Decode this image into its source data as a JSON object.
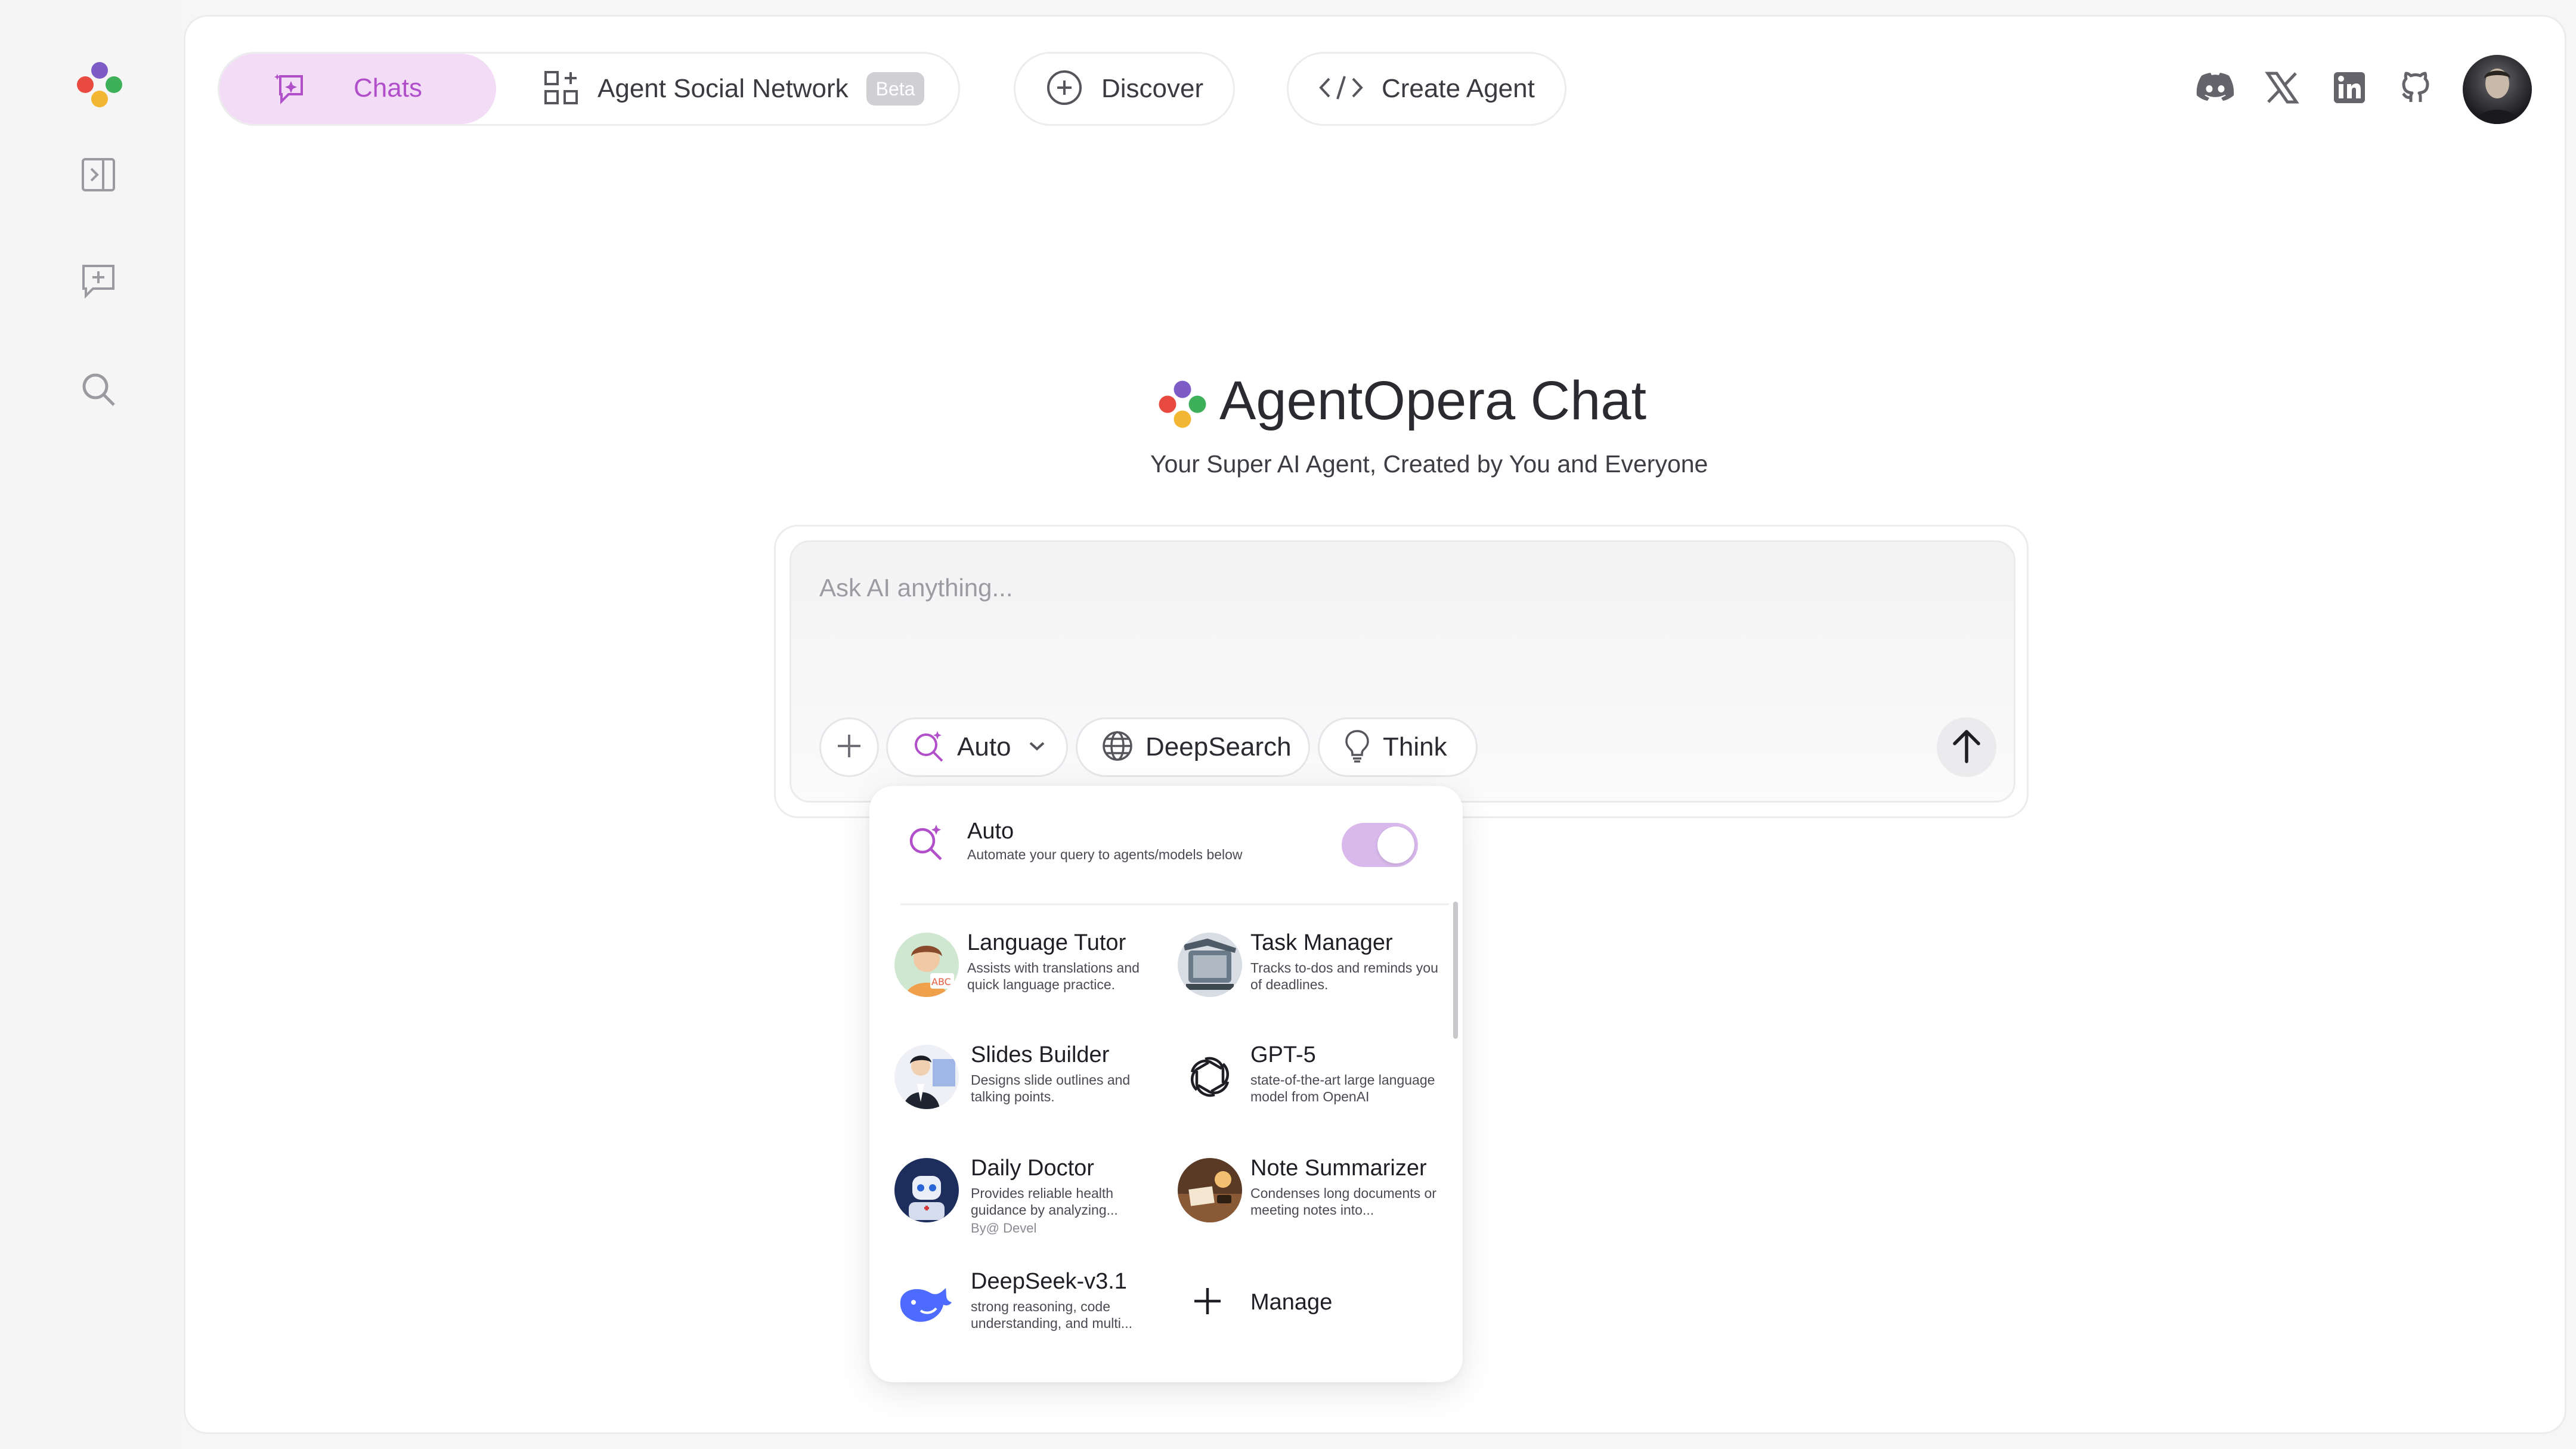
{
  "nav": {
    "chats": "Chats",
    "agent_social_network": "Agent Social Network",
    "beta_badge": "Beta",
    "discover": "Discover",
    "create_agent": "Create Agent"
  },
  "hero": {
    "title": "AgentOpera Chat",
    "subtitle": "Your Super AI Agent, Created by You and Everyone"
  },
  "composer": {
    "placeholder": "Ask AI anything...",
    "auto": "Auto",
    "deepsearch": "DeepSearch",
    "think": "Think"
  },
  "dropdown": {
    "auto_title": "Auto",
    "auto_desc": "Automate your query to agents/models below",
    "auto_enabled": true,
    "agents": [
      {
        "title": "Language Tutor",
        "desc": "Assists with translations and quick language practice."
      },
      {
        "title": "Task Manager",
        "desc": "Tracks to-dos and reminds you of deadlines."
      },
      {
        "title": "Slides Builder",
        "desc": "Designs slide outlines and talking points."
      },
      {
        "title": "GPT-5",
        "desc": "state-of-the-art large language model from OpenAI"
      },
      {
        "title": "Daily Doctor",
        "desc": "Provides reliable health guidance by analyzing...",
        "by": "By@ Devel"
      },
      {
        "title": "Note Summarizer",
        "desc": "Condenses long documents or meeting notes into..."
      },
      {
        "title": "DeepSeek-v3.1",
        "desc": "strong reasoning, code understanding, and multi..."
      }
    ],
    "manage": "Manage"
  },
  "colors": {
    "accent_purple": "#b04fc9",
    "chats_pill_bg": "#f3ddf6",
    "toggle_on": "#d9b9ec",
    "logo_purple": "#7e5cc8",
    "logo_red": "#e84a3f",
    "logo_green": "#3fb05a",
    "logo_yellow": "#f2b632"
  }
}
